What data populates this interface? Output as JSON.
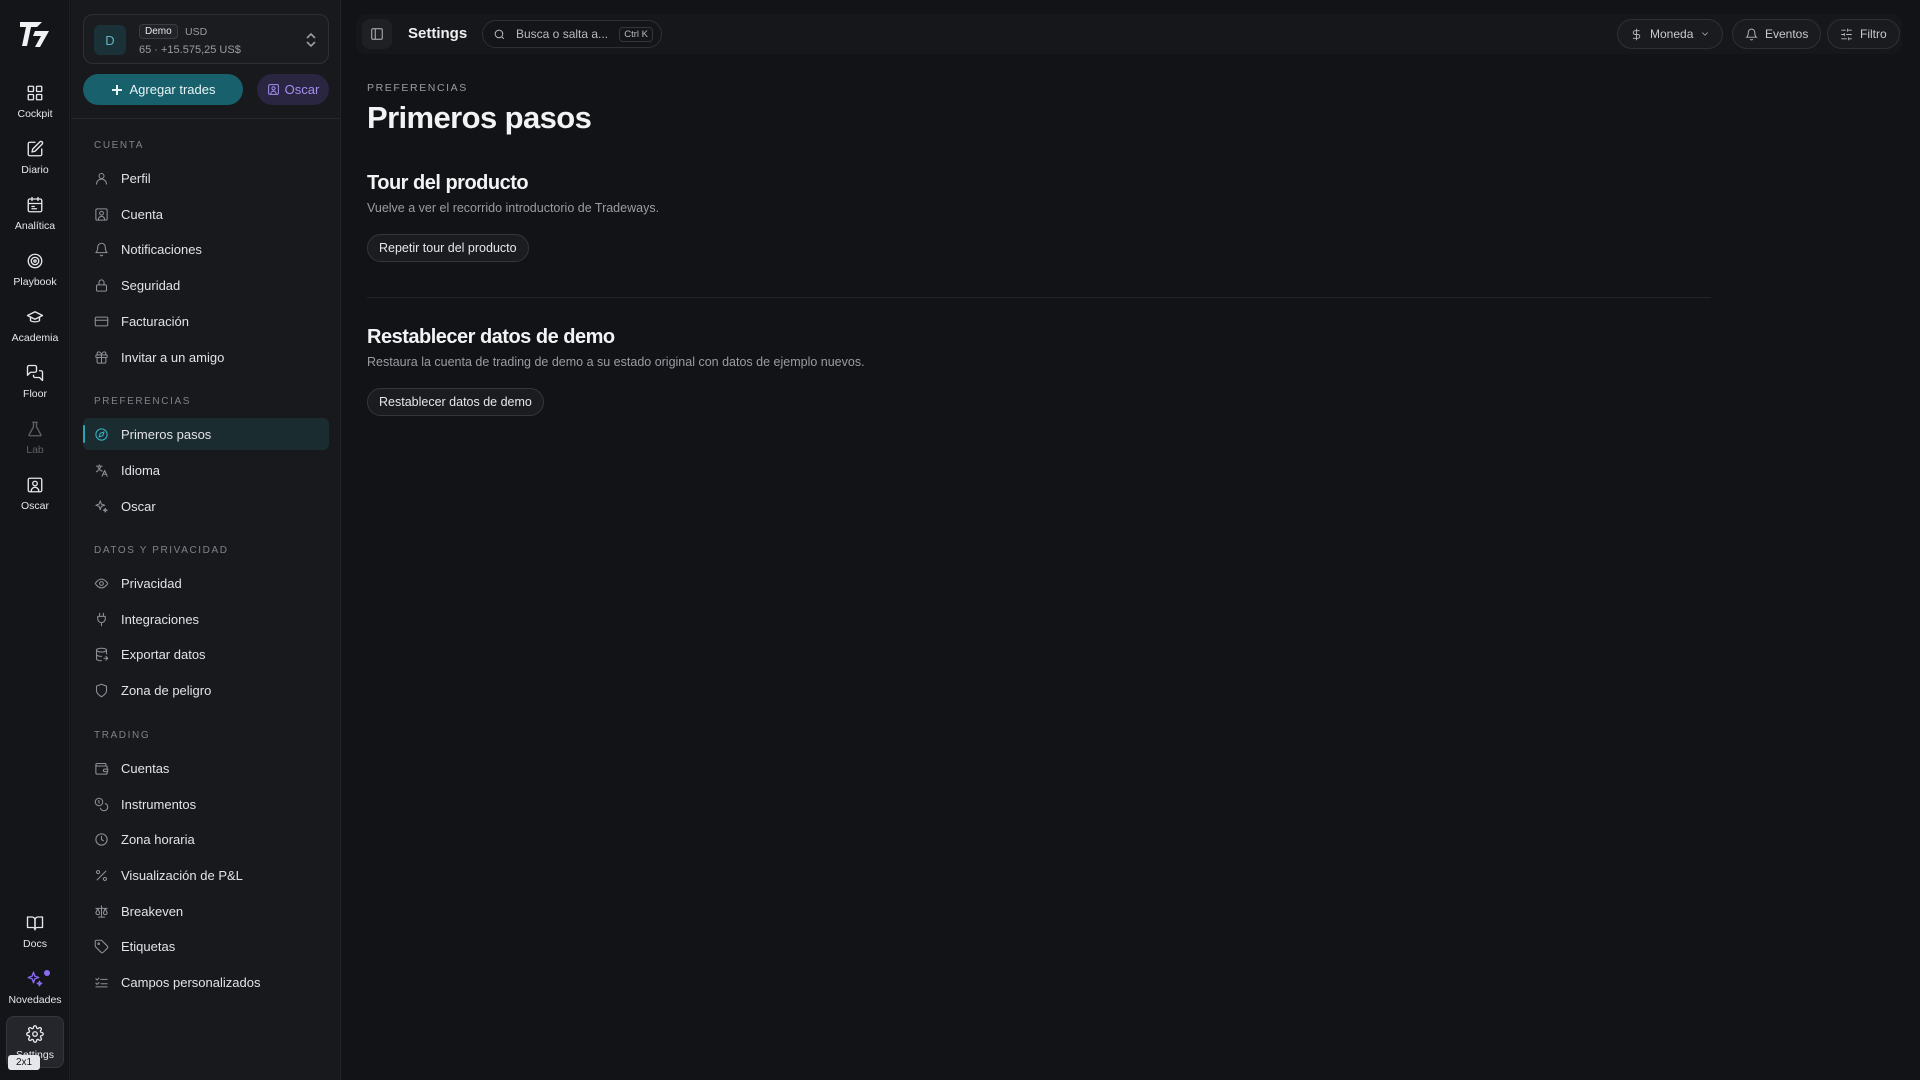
{
  "rail": {
    "items": [
      {
        "label": "Cockpit",
        "icon": "dashboard-grid-icon"
      },
      {
        "label": "Diario",
        "icon": "journal-edit-icon"
      },
      {
        "label": "Analítica",
        "icon": "calendar-chart-icon"
      },
      {
        "label": "Playbook",
        "icon": "target-icon"
      },
      {
        "label": "Academia",
        "icon": "graduation-cap-icon"
      },
      {
        "label": "Floor",
        "icon": "chat-bubbles-icon"
      },
      {
        "label": "Lab",
        "icon": "flask-icon"
      },
      {
        "label": "Oscar",
        "icon": "user-card-icon"
      }
    ],
    "bottom": [
      {
        "label": "Docs",
        "icon": "book-icon"
      },
      {
        "label": "Novedades",
        "icon": "sparkles-icon"
      },
      {
        "label": "Settings",
        "icon": "gear-icon"
      }
    ],
    "hint": "2x1"
  },
  "account": {
    "avatar": "D",
    "badge": "Demo",
    "currency": "USD",
    "summary": "65 · +15.575,25 US$"
  },
  "actions": {
    "add_trades": "Agregar trades",
    "oscar": "Oscar"
  },
  "sidebar": {
    "sections": [
      {
        "title": "CUENTA",
        "items": [
          "Perfil",
          "Cuenta",
          "Notificaciones",
          "Seguridad",
          "Facturación",
          "Invitar a un amigo"
        ]
      },
      {
        "title": "PREFERENCIAS",
        "items": [
          "Primeros pasos",
          "Idioma",
          "Oscar"
        ]
      },
      {
        "title": "DATOS Y PRIVACIDAD",
        "items": [
          "Privacidad",
          "Integraciones",
          "Exportar datos",
          "Zona de peligro"
        ]
      },
      {
        "title": "TRADING",
        "items": [
          "Cuentas",
          "Instrumentos",
          "Zona horaria",
          "Visualización de P&L",
          "Breakeven",
          "Etiquetas",
          "Campos personalizados"
        ]
      }
    ],
    "active": "Primeros pasos"
  },
  "topbar": {
    "title": "Settings",
    "search_placeholder": "Busca o salta a...",
    "search_shortcut": "Ctrl K",
    "currency_label": "Moneda",
    "events_label": "Eventos",
    "filter_label": "Filtro"
  },
  "page": {
    "eyebrow": "PREFERENCIAS",
    "title": "Primeros pasos",
    "tour": {
      "title": "Tour del producto",
      "description": "Vuelve a ver el recorrido introductorio de Tradeways.",
      "button": "Repetir tour del producto"
    },
    "reset": {
      "title": "Restablecer datos de demo",
      "description": "Restaura la cuenta de trading de demo a su estado original con datos de ejemplo nuevos.",
      "button": "Restablecer datos de demo"
    }
  },
  "colors": {
    "accent": "#17606c",
    "oscar": "#a490f2",
    "background": "#121316"
  }
}
